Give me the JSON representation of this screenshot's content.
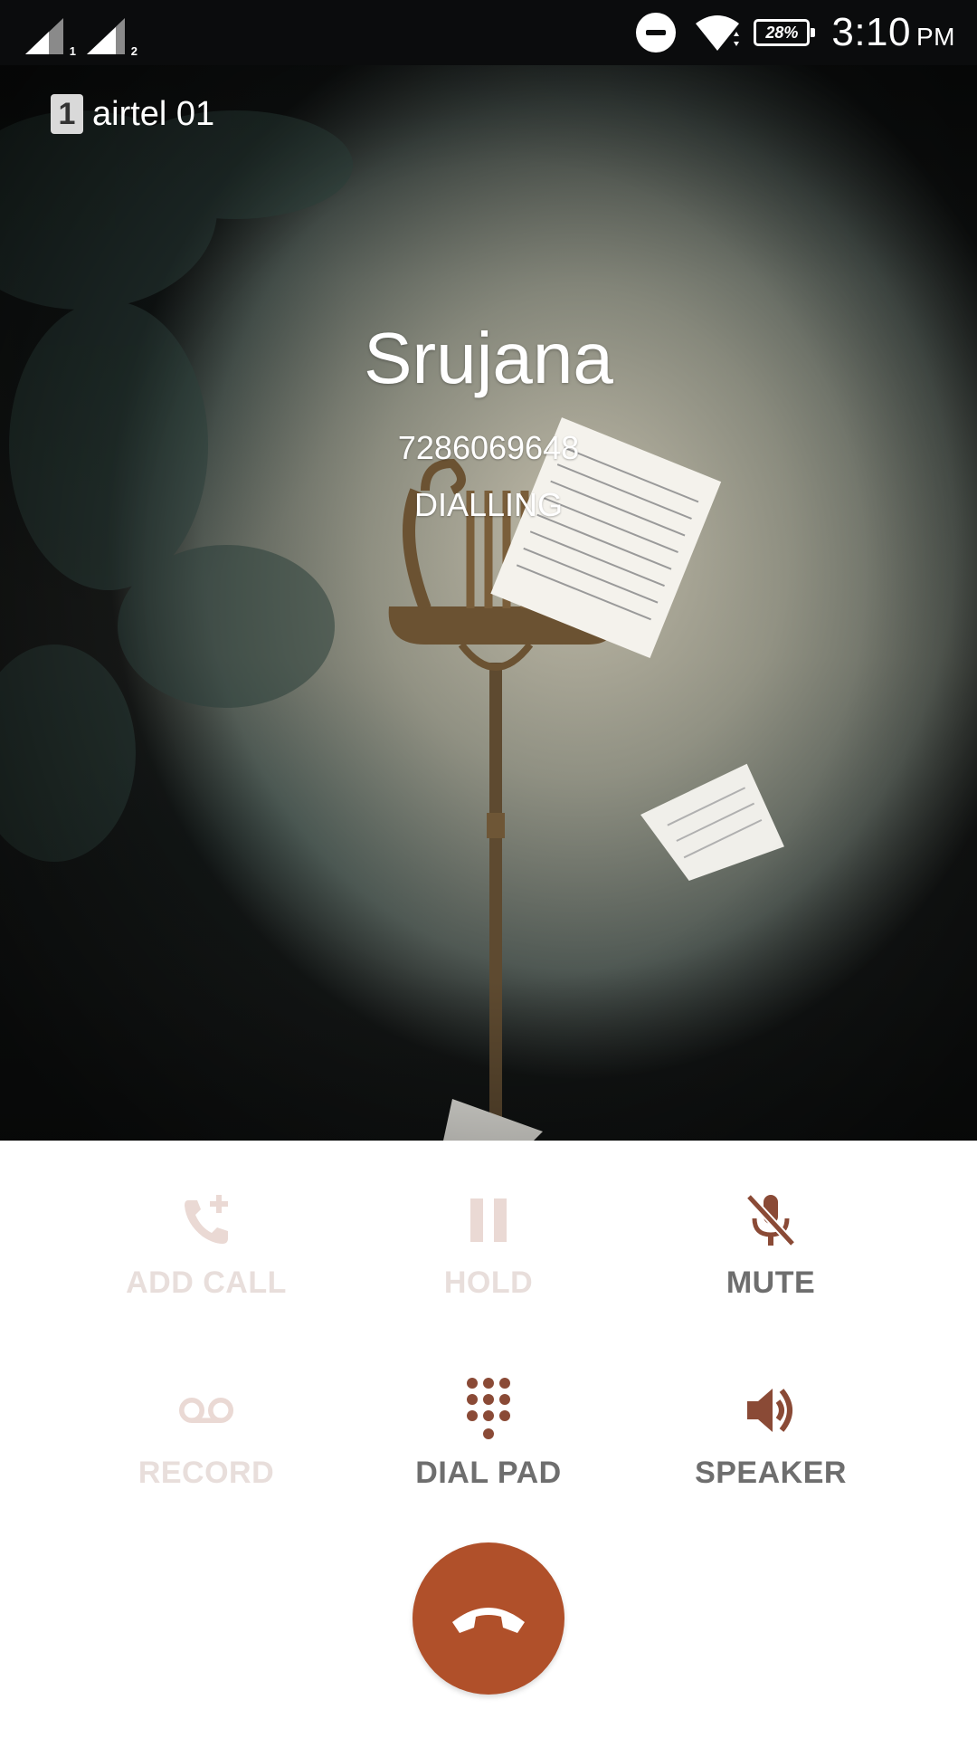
{
  "status_bar": {
    "sim1_label": "1",
    "sim2_label": "2",
    "battery": "28%",
    "time": "3:10",
    "ampm": "PM"
  },
  "call": {
    "sim_slot": "1",
    "carrier": "airtel 01",
    "caller_name": "Srujana",
    "caller_number": "7286069648",
    "status": "DIALLING"
  },
  "controls": {
    "add_call": "ADD CALL",
    "hold": "HOLD",
    "mute": "MUTE",
    "record": "RECORD",
    "dial_pad": "DIAL PAD",
    "speaker": "SPEAKER"
  },
  "icons": {
    "add_call": "add-call-icon",
    "hold": "pause-icon",
    "mute": "mic-off-icon",
    "record": "voicemail-icon",
    "dial_pad": "dialpad-icon",
    "speaker": "speaker-icon",
    "end_call": "end-call-icon"
  },
  "colors": {
    "accent": "#b0502a",
    "icon_enabled": "#8a4a36",
    "icon_disabled": "#ead9d4",
    "label_enabled": "#6e6e6e",
    "label_disabled": "#e8dedb"
  }
}
